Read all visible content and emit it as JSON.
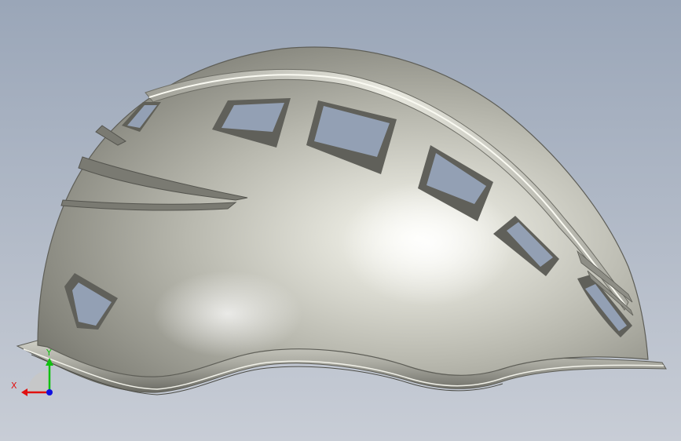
{
  "viewport": {
    "background_top": "#9aa6b8",
    "background_bottom": "#c8cdd6"
  },
  "model": {
    "shell_base": "#b9b9b0",
    "shell_dark": "#6e6e66",
    "shell_light": "#f4f4ec",
    "vent_color": "#93a0b4"
  },
  "triad": {
    "x_label": "X",
    "y_label": "Y",
    "x_color": "#e01010",
    "y_color": "#10c010",
    "z_color": "#1010e0"
  }
}
